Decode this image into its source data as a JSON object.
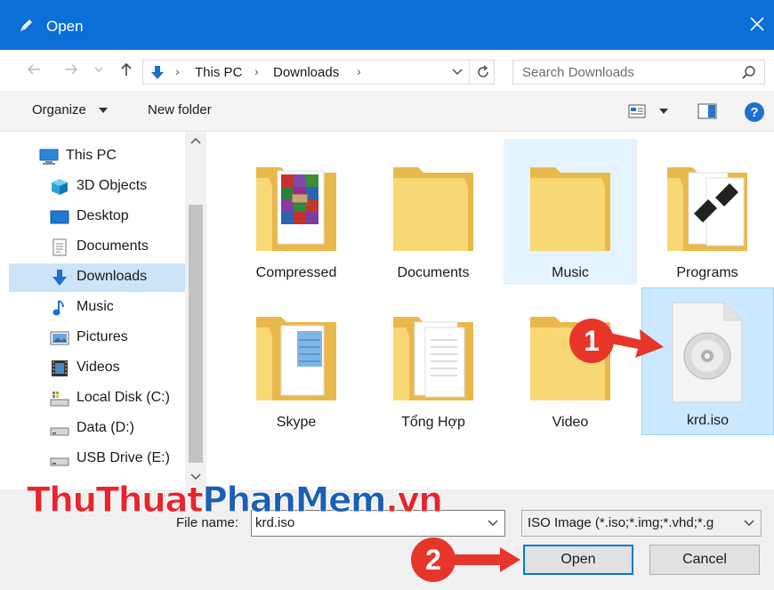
{
  "window": {
    "title": "Open",
    "title_icon": "pen-icon",
    "close_icon": "close-icon"
  },
  "address": {
    "back_icon": "back-arrow-icon",
    "forward_icon": "forward-arrow-icon",
    "recent_icon": "chevron-down-icon",
    "up_icon": "up-arrow-icon",
    "location_icon": "download-icon",
    "segments": [
      "This PC",
      "Downloads"
    ],
    "dropdown_icon": "chevron-down-icon",
    "refresh_icon": "refresh-icon"
  },
  "search": {
    "placeholder": "Search Downloads",
    "icon": "search-icon"
  },
  "toolbar": {
    "organize_label": "Organize",
    "new_folder_label": "New folder",
    "view_icon": "view-icon",
    "preview_icon": "preview-pane-icon",
    "help_icon": "help-icon"
  },
  "nav": {
    "items": [
      {
        "label": "This PC",
        "icon": "computer-icon",
        "selected": false
      },
      {
        "label": "3D Objects",
        "icon": "3d-objects-icon",
        "selected": false
      },
      {
        "label": "Desktop",
        "icon": "desktop-icon",
        "selected": false
      },
      {
        "label": "Documents",
        "icon": "documents-icon",
        "selected": false
      },
      {
        "label": "Downloads",
        "icon": "downloads-icon",
        "selected": true
      },
      {
        "label": "Music",
        "icon": "music-icon",
        "selected": false
      },
      {
        "label": "Pictures",
        "icon": "pictures-icon",
        "selected": false
      },
      {
        "label": "Videos",
        "icon": "videos-icon",
        "selected": false
      },
      {
        "label": "Local Disk (C:)",
        "icon": "local-disk-icon",
        "selected": false
      },
      {
        "label": "Data (D:)",
        "icon": "drive-icon",
        "selected": false
      },
      {
        "label": "USB Drive (E:)",
        "icon": "usb-drive-icon",
        "selected": false
      }
    ]
  },
  "files": [
    {
      "name": "Compressed",
      "icon": "folder-icon",
      "state": "normal"
    },
    {
      "name": "Documents",
      "icon": "folder-icon",
      "state": "normal"
    },
    {
      "name": "Music",
      "icon": "folder-icon",
      "state": "hover"
    },
    {
      "name": "Programs",
      "icon": "folder-icon",
      "state": "normal"
    },
    {
      "name": "Skype",
      "icon": "folder-icon",
      "state": "normal"
    },
    {
      "name": "Tổng Hợp",
      "icon": "folder-icon",
      "state": "normal"
    },
    {
      "name": "Video",
      "icon": "folder-icon",
      "state": "normal"
    },
    {
      "name": "krd.iso",
      "icon": "disc-image-icon",
      "state": "selected"
    }
  ],
  "filename": {
    "label": "File name:",
    "value": "krd.iso"
  },
  "filetype": {
    "value": "ISO Image (*.iso;*.img;*.vhd;*.g"
  },
  "buttons": {
    "open": "Open",
    "cancel": "Cancel"
  },
  "annotations": {
    "step1": "1",
    "step2": "2"
  },
  "watermark": {
    "part1": "ThuThuat",
    "part2": "PhanMem",
    "part3": ".vn"
  },
  "colors": {
    "titlebar": "#0a6fd6",
    "selection": "#cce8ff",
    "folder": "#f8d775",
    "callout": "#e8352a",
    "watermark_red": "#e8242d",
    "watermark_blue": "#1b5fb5"
  }
}
